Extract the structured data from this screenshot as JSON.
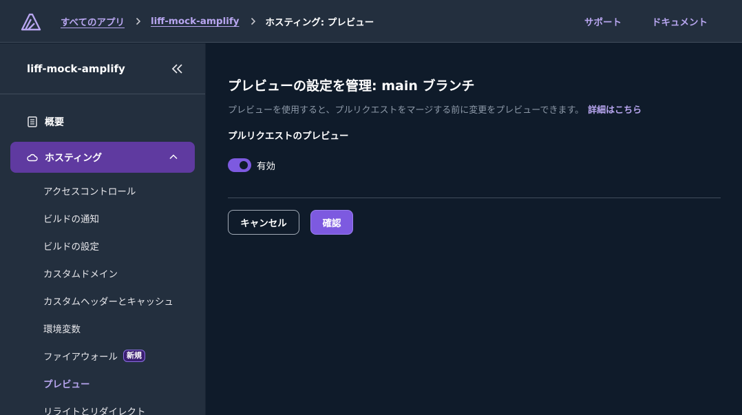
{
  "header": {
    "breadcrumbs": [
      "すべてのアプリ",
      "liff-mock-amplify"
    ],
    "current": "ホスティング: プレビュー",
    "support": "サポート",
    "docs": "ドキュメント"
  },
  "sidebar": {
    "app_name": "liff-mock-amplify",
    "overview": "概要",
    "hosting": "ホスティング",
    "sub_items": [
      {
        "label": "アクセスコントロール"
      },
      {
        "label": "ビルドの通知"
      },
      {
        "label": "ビルドの設定"
      },
      {
        "label": "カスタムドメイン"
      },
      {
        "label": "カスタムヘッダーとキャッシュ"
      },
      {
        "label": "環境変数"
      },
      {
        "label": "ファイアウォール",
        "badge": "新規"
      },
      {
        "label": "プレビュー"
      },
      {
        "label": "リライトとリダイレクト"
      }
    ]
  },
  "main": {
    "title": "プレビューの設定を管理: main ブランチ",
    "description": "プレビューを使用すると、プルリクエストをマージする前に変更をプレビューできます。",
    "learn_more": "詳細はこちら",
    "section_label": "プルリクエストのプレビュー",
    "toggle_label": "有効",
    "toggle_on": true,
    "cancel": "キャンセル",
    "confirm": "確認"
  },
  "colors": {
    "accent": "#7d5ae0",
    "active_nav": "#5f3aa0",
    "link": "#b8a6f0",
    "header_bg": "#232f3e",
    "main_bg": "#0f1b2a"
  }
}
